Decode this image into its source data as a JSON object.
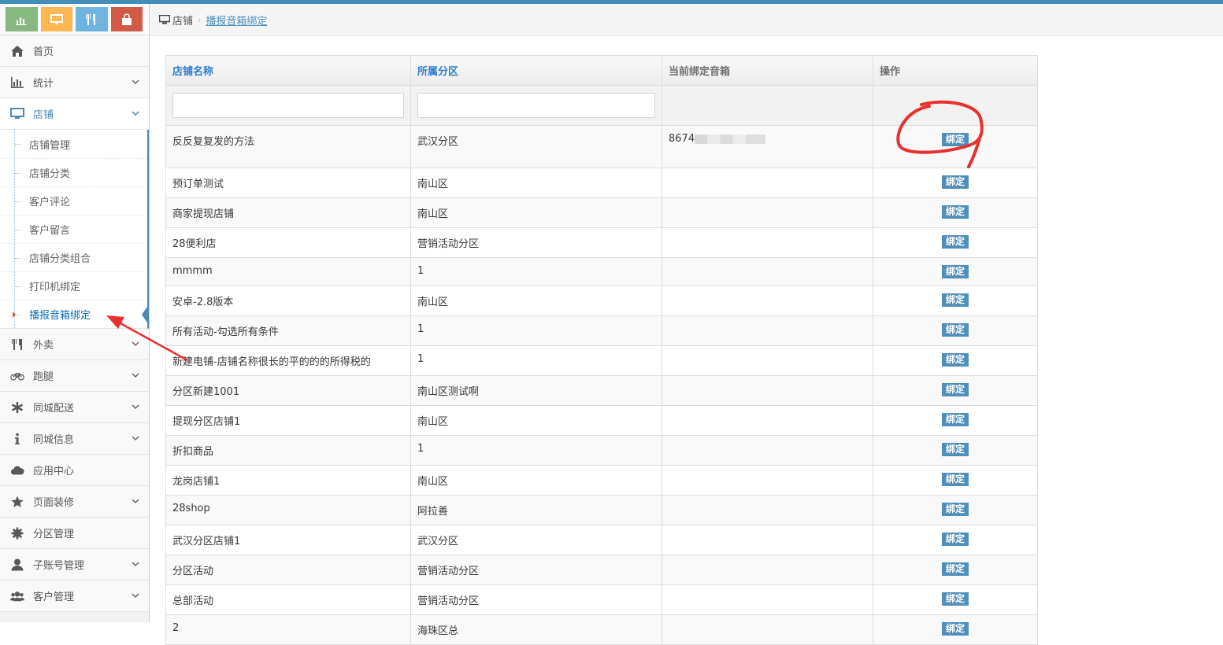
{
  "breadcrumb": {
    "home": "店铺",
    "current": "播报音箱绑定"
  },
  "sidebar": {
    "shortcuts": [
      {
        "icon": "bar-chart-icon",
        "color": "#87b87f"
      },
      {
        "icon": "desktop-icon",
        "color": "#ffb752"
      },
      {
        "icon": "cutlery-icon",
        "color": "#6fb3e0"
      },
      {
        "icon": "shopping-bag-icon",
        "color": "#d15b47"
      }
    ],
    "items": [
      {
        "label": "首页"
      },
      {
        "label": "统计"
      },
      {
        "label": "店铺"
      },
      {
        "label": "外卖"
      },
      {
        "label": "跑腿"
      },
      {
        "label": "同城配送"
      },
      {
        "label": "同城信息"
      },
      {
        "label": "应用中心"
      },
      {
        "label": "页面装修"
      },
      {
        "label": "分区管理"
      },
      {
        "label": "子账号管理"
      },
      {
        "label": "客户管理"
      }
    ],
    "submenu": [
      {
        "label": "店铺管理"
      },
      {
        "label": "店铺分类"
      },
      {
        "label": "客户评论"
      },
      {
        "label": "客户留言"
      },
      {
        "label": "店铺分类组合"
      },
      {
        "label": "打印机绑定"
      },
      {
        "label": "播报音箱绑定"
      }
    ]
  },
  "table": {
    "columns": [
      "店铺名称",
      "所属分区",
      "当前绑定音箱",
      "操作"
    ],
    "action_label": "绑定",
    "rows": [
      {
        "name": "反反复复发的方法",
        "zone": "武汉分区",
        "speaker": "8674"
      },
      {
        "name": "预订单测试",
        "zone": "南山区",
        "speaker": ""
      },
      {
        "name": "商家提现店铺",
        "zone": "南山区",
        "speaker": ""
      },
      {
        "name": "28便利店",
        "zone": "营销活动分区",
        "speaker": ""
      },
      {
        "name": "mmmm",
        "zone": "1",
        "speaker": ""
      },
      {
        "name": "安卓-2.8版本",
        "zone": "南山区",
        "speaker": ""
      },
      {
        "name": "所有活动-勾选所有条件",
        "zone": "1",
        "speaker": ""
      },
      {
        "name": "新建电铺-店铺名称很长的平的的的所得税的",
        "zone": "1",
        "speaker": ""
      },
      {
        "name": "分区新建1001",
        "zone": "南山区测试啊",
        "speaker": ""
      },
      {
        "name": "提现分区店铺1",
        "zone": "南山区",
        "speaker": ""
      },
      {
        "name": "折扣商品",
        "zone": "1",
        "speaker": ""
      },
      {
        "name": "龙岗店铺1",
        "zone": "南山区",
        "speaker": ""
      },
      {
        "name": "28shop",
        "zone": "阿拉善",
        "speaker": ""
      },
      {
        "name": "武汉分区店铺1",
        "zone": "武汉分区",
        "speaker": ""
      },
      {
        "name": "分区活动",
        "zone": "营销活动分区",
        "speaker": ""
      },
      {
        "name": "总部活动",
        "zone": "营销活动分区",
        "speaker": ""
      },
      {
        "name": "2",
        "zone": "海珠区总",
        "speaker": ""
      }
    ]
  },
  "colors": {
    "accent": "#438eb9",
    "button": "#4f8fba",
    "annotation": "#e8312e"
  }
}
